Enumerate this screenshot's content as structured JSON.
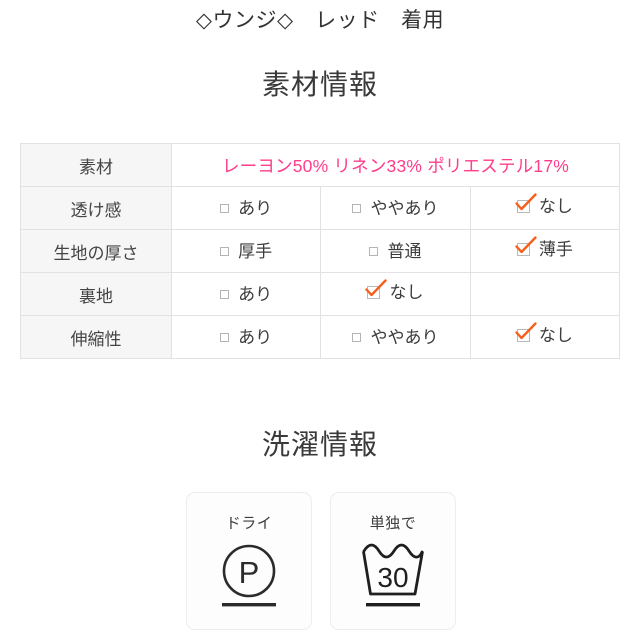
{
  "caption": "◇ウンジ◇　レッド　着用",
  "sections": {
    "material_heading": "素材情報",
    "wash_heading": "洗濯情報"
  },
  "colors": {
    "material_pink": "#ff3d8b",
    "check_orange": "#f4601c",
    "label_bg": "#f6f6f6",
    "border": "#e2e2e2",
    "text": "#3c3c3c"
  },
  "material_table": {
    "rows": [
      {
        "label": "素材",
        "type": "text",
        "text": "レーヨン50% リネン33% ポリエステル17%"
      },
      {
        "label": "透け感",
        "type": "options",
        "options": [
          {
            "label": "あり",
            "checked": false
          },
          {
            "label": "ややあり",
            "checked": false
          },
          {
            "label": "なし",
            "checked": true
          }
        ]
      },
      {
        "label": "生地の厚さ",
        "type": "options",
        "options": [
          {
            "label": "厚手",
            "checked": false
          },
          {
            "label": "普通",
            "checked": false
          },
          {
            "label": "薄手",
            "checked": true
          }
        ]
      },
      {
        "label": "裏地",
        "type": "options",
        "options": [
          {
            "label": "あり",
            "checked": false
          },
          {
            "label": "なし",
            "checked": true
          },
          {
            "label": "",
            "checked": false,
            "empty": true
          }
        ]
      },
      {
        "label": "伸縮性",
        "type": "options",
        "options": [
          {
            "label": "あり",
            "checked": false
          },
          {
            "label": "ややあり",
            "checked": false
          },
          {
            "label": "なし",
            "checked": true
          }
        ]
      }
    ]
  },
  "wash_cards": [
    {
      "title": "ドライ",
      "symbol": "dry-clean-p-icon",
      "symbol_text": "P"
    },
    {
      "title": "単独で",
      "symbol": "wash-tub-30-icon",
      "symbol_text": "30"
    }
  ]
}
